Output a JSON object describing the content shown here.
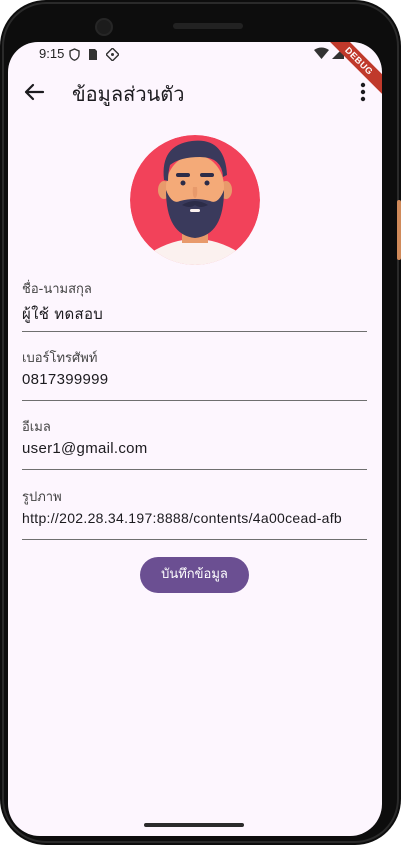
{
  "status_bar": {
    "time": "9:15",
    "debug_label": "DEBUG"
  },
  "app_bar": {
    "title": "ข้อมูลส่วนตัว",
    "back_icon": "arrow-back-icon",
    "menu_icon": "more-vert-icon"
  },
  "profile": {
    "avatar_icon": "bearded-man-avatar"
  },
  "form": {
    "fields": [
      {
        "label": "ชื่อ-นามสกุล",
        "value": "ผู้ใช้ ทดสอบ"
      },
      {
        "label": "เบอร์โทรศัพท์",
        "value": "0817399999"
      },
      {
        "label": "อีเมล",
        "value": "user1@gmail.com"
      },
      {
        "label": "รูปภาพ",
        "value": "http://202.28.34.197:8888/contents/4a00cead-afb"
      }
    ],
    "save_label": "บันทึกข้อมูล"
  },
  "colors": {
    "background": "#fdf6fe",
    "accent": "#6b4f92",
    "avatar_bg": "#f2425a"
  }
}
